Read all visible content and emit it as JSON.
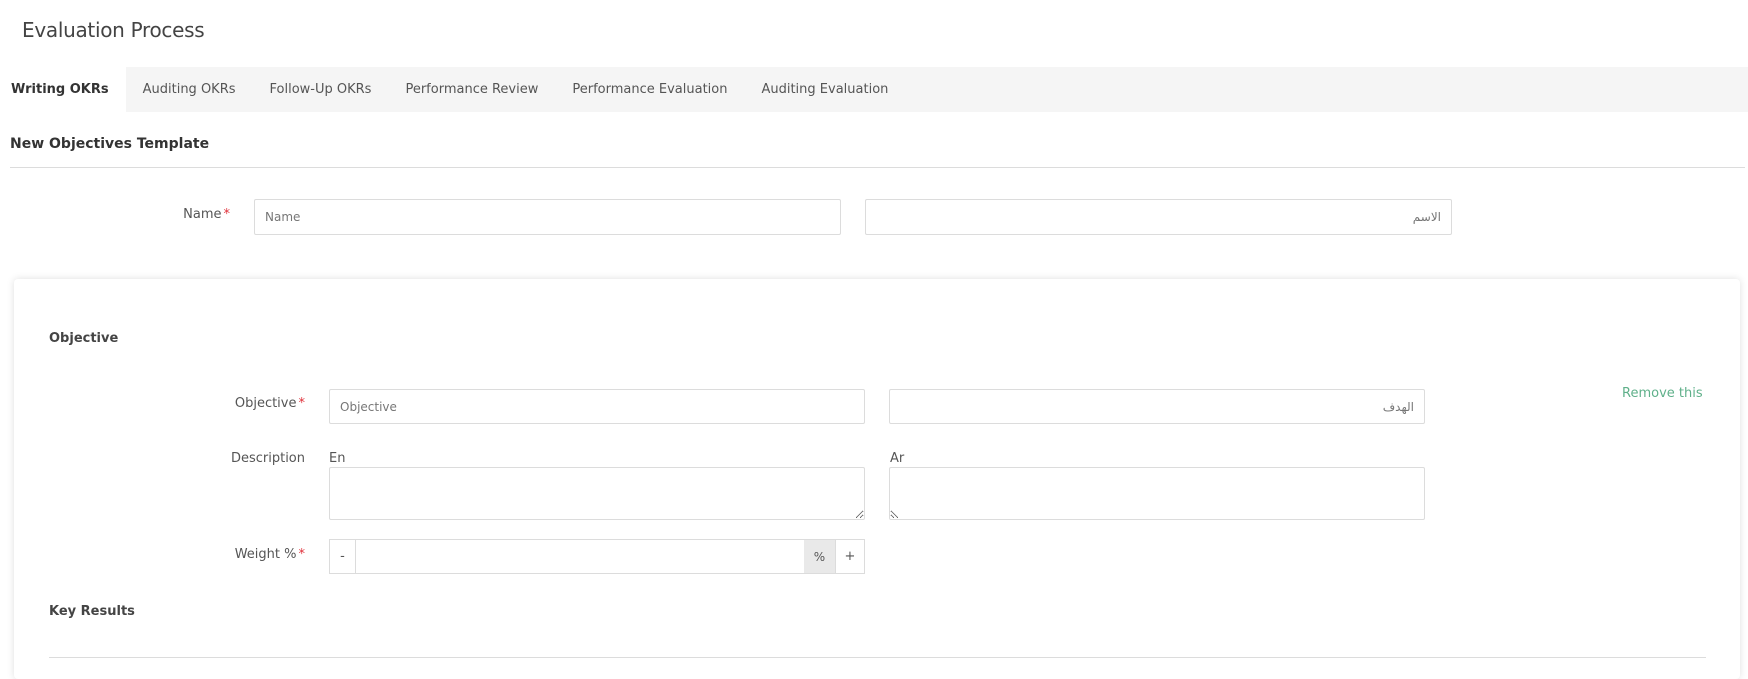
{
  "page": {
    "title": "Evaluation Process"
  },
  "tabs": [
    {
      "label": "Writing OKRs",
      "active": true
    },
    {
      "label": "Auditing OKRs"
    },
    {
      "label": "Follow-Up OKRs"
    },
    {
      "label": "Performance Review"
    },
    {
      "label": "Performance Evaluation"
    },
    {
      "label": "Auditing Evaluation"
    }
  ],
  "template": {
    "section_title": "New Objectives Template",
    "name_label": "Name",
    "required_mark": "*",
    "name_en_placeholder": "Name",
    "name_ar_placeholder": "الاسم"
  },
  "objective_card": {
    "title": "Objective",
    "remove_label": "Remove this",
    "objective_label": "Objective",
    "objective_en_placeholder": "Objective",
    "objective_ar_placeholder": "الهدف",
    "description_label": "Description",
    "desc_en_label": "En",
    "desc_ar_label": "Ar",
    "weight_label": "Weight %",
    "weight_minus": "-",
    "weight_unit": "%",
    "weight_plus": "+",
    "key_results_title": "Key Results"
  },
  "colors": {
    "required": "#e0303a",
    "link": "#5fb08a",
    "tab_bar": "#f5f5f5"
  }
}
